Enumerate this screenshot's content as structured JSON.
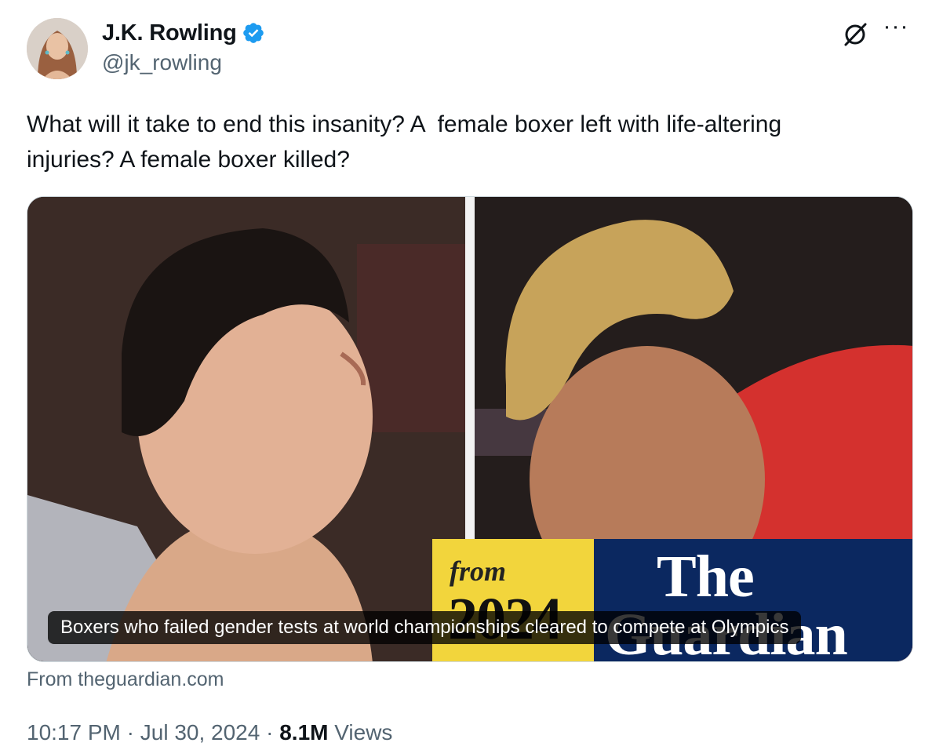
{
  "author": {
    "display_name": "J.K. Rowling",
    "handle": "@jk_rowling",
    "verified_color": "#1d9bf0"
  },
  "tweet": {
    "text": "What will it take to end this insanity? A  female boxer left with life-altering injuries? A female boxer killed?"
  },
  "card": {
    "caption": "Boxers who failed gender tests at world championships cleared to compete at Olympics",
    "badge_from": "from",
    "badge_year": "2024",
    "brand_line1": "The",
    "brand_line2": "Guardian",
    "source": "From theguardian.com"
  },
  "meta": {
    "time": "10:17 PM",
    "separator": "·",
    "date": "Jul 30, 2024",
    "views_count": "8.1M",
    "views_label": "Views"
  },
  "icons": {
    "grok": "grok-icon",
    "more": "more-icon",
    "verified": "verified-badge-icon"
  },
  "colors": {
    "text_primary": "#0f1419",
    "text_secondary": "#536471",
    "guardian_blue": "#0b2860",
    "badge_yellow": "#f2d53c"
  }
}
